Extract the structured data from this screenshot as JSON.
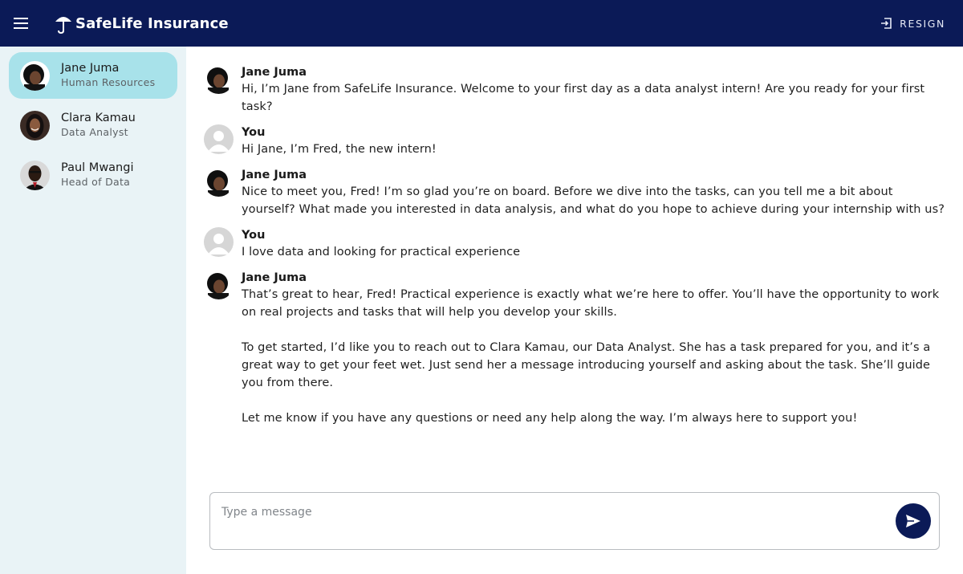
{
  "header": {
    "brand": "SafeLife Insurance",
    "resign_label": "RESIGN",
    "colors": {
      "bar": "#0b1a57"
    }
  },
  "sidebar": {
    "contacts": [
      {
        "name": "Jane Juma",
        "role": "Human Resources",
        "active": true
      },
      {
        "name": "Clara Kamau",
        "role": "Data Analyst",
        "active": false
      },
      {
        "name": "Paul Mwangi",
        "role": "Head of Data",
        "active": false
      }
    ]
  },
  "messages": [
    {
      "sender": "Jane Juma",
      "paragraphs": [
        "Hi, I’m Jane from SafeLife Insurance. Welcome to your first day as a data analyst intern! Are you ready for your first task?"
      ]
    },
    {
      "sender": "You",
      "paragraphs": [
        "Hi Jane, I’m Fred, the new intern!"
      ]
    },
    {
      "sender": "Jane Juma",
      "paragraphs": [
        "Nice to meet you, Fred! I’m so glad you’re on board. Before we dive into the tasks, can you tell me a bit about yourself? What made you interested in data analysis, and what do you hope to achieve during your internship with us?"
      ]
    },
    {
      "sender": "You",
      "paragraphs": [
        "I love data and looking for practical experience"
      ]
    },
    {
      "sender": "Jane Juma",
      "paragraphs": [
        "That’s great to hear, Fred! Practical experience is exactly what we’re here to offer. You’ll have the opportunity to work on real projects and tasks that will help you develop your skills.",
        "To get started, I’d like you to reach out to Clara Kamau, our Data Analyst. She has a task prepared for you, and it’s a great way to get your feet wet. Just send her a message introducing yourself and asking about the task. She’ll guide you from there.",
        "Let me know if you have any questions or need any help along the way. I’m always here to support you!"
      ]
    }
  ],
  "composer": {
    "placeholder": "Type a message",
    "value": ""
  },
  "icons": {
    "menu": "menu-icon",
    "logo": "umbrella-icon",
    "resign": "logout-icon",
    "send": "send-icon"
  }
}
